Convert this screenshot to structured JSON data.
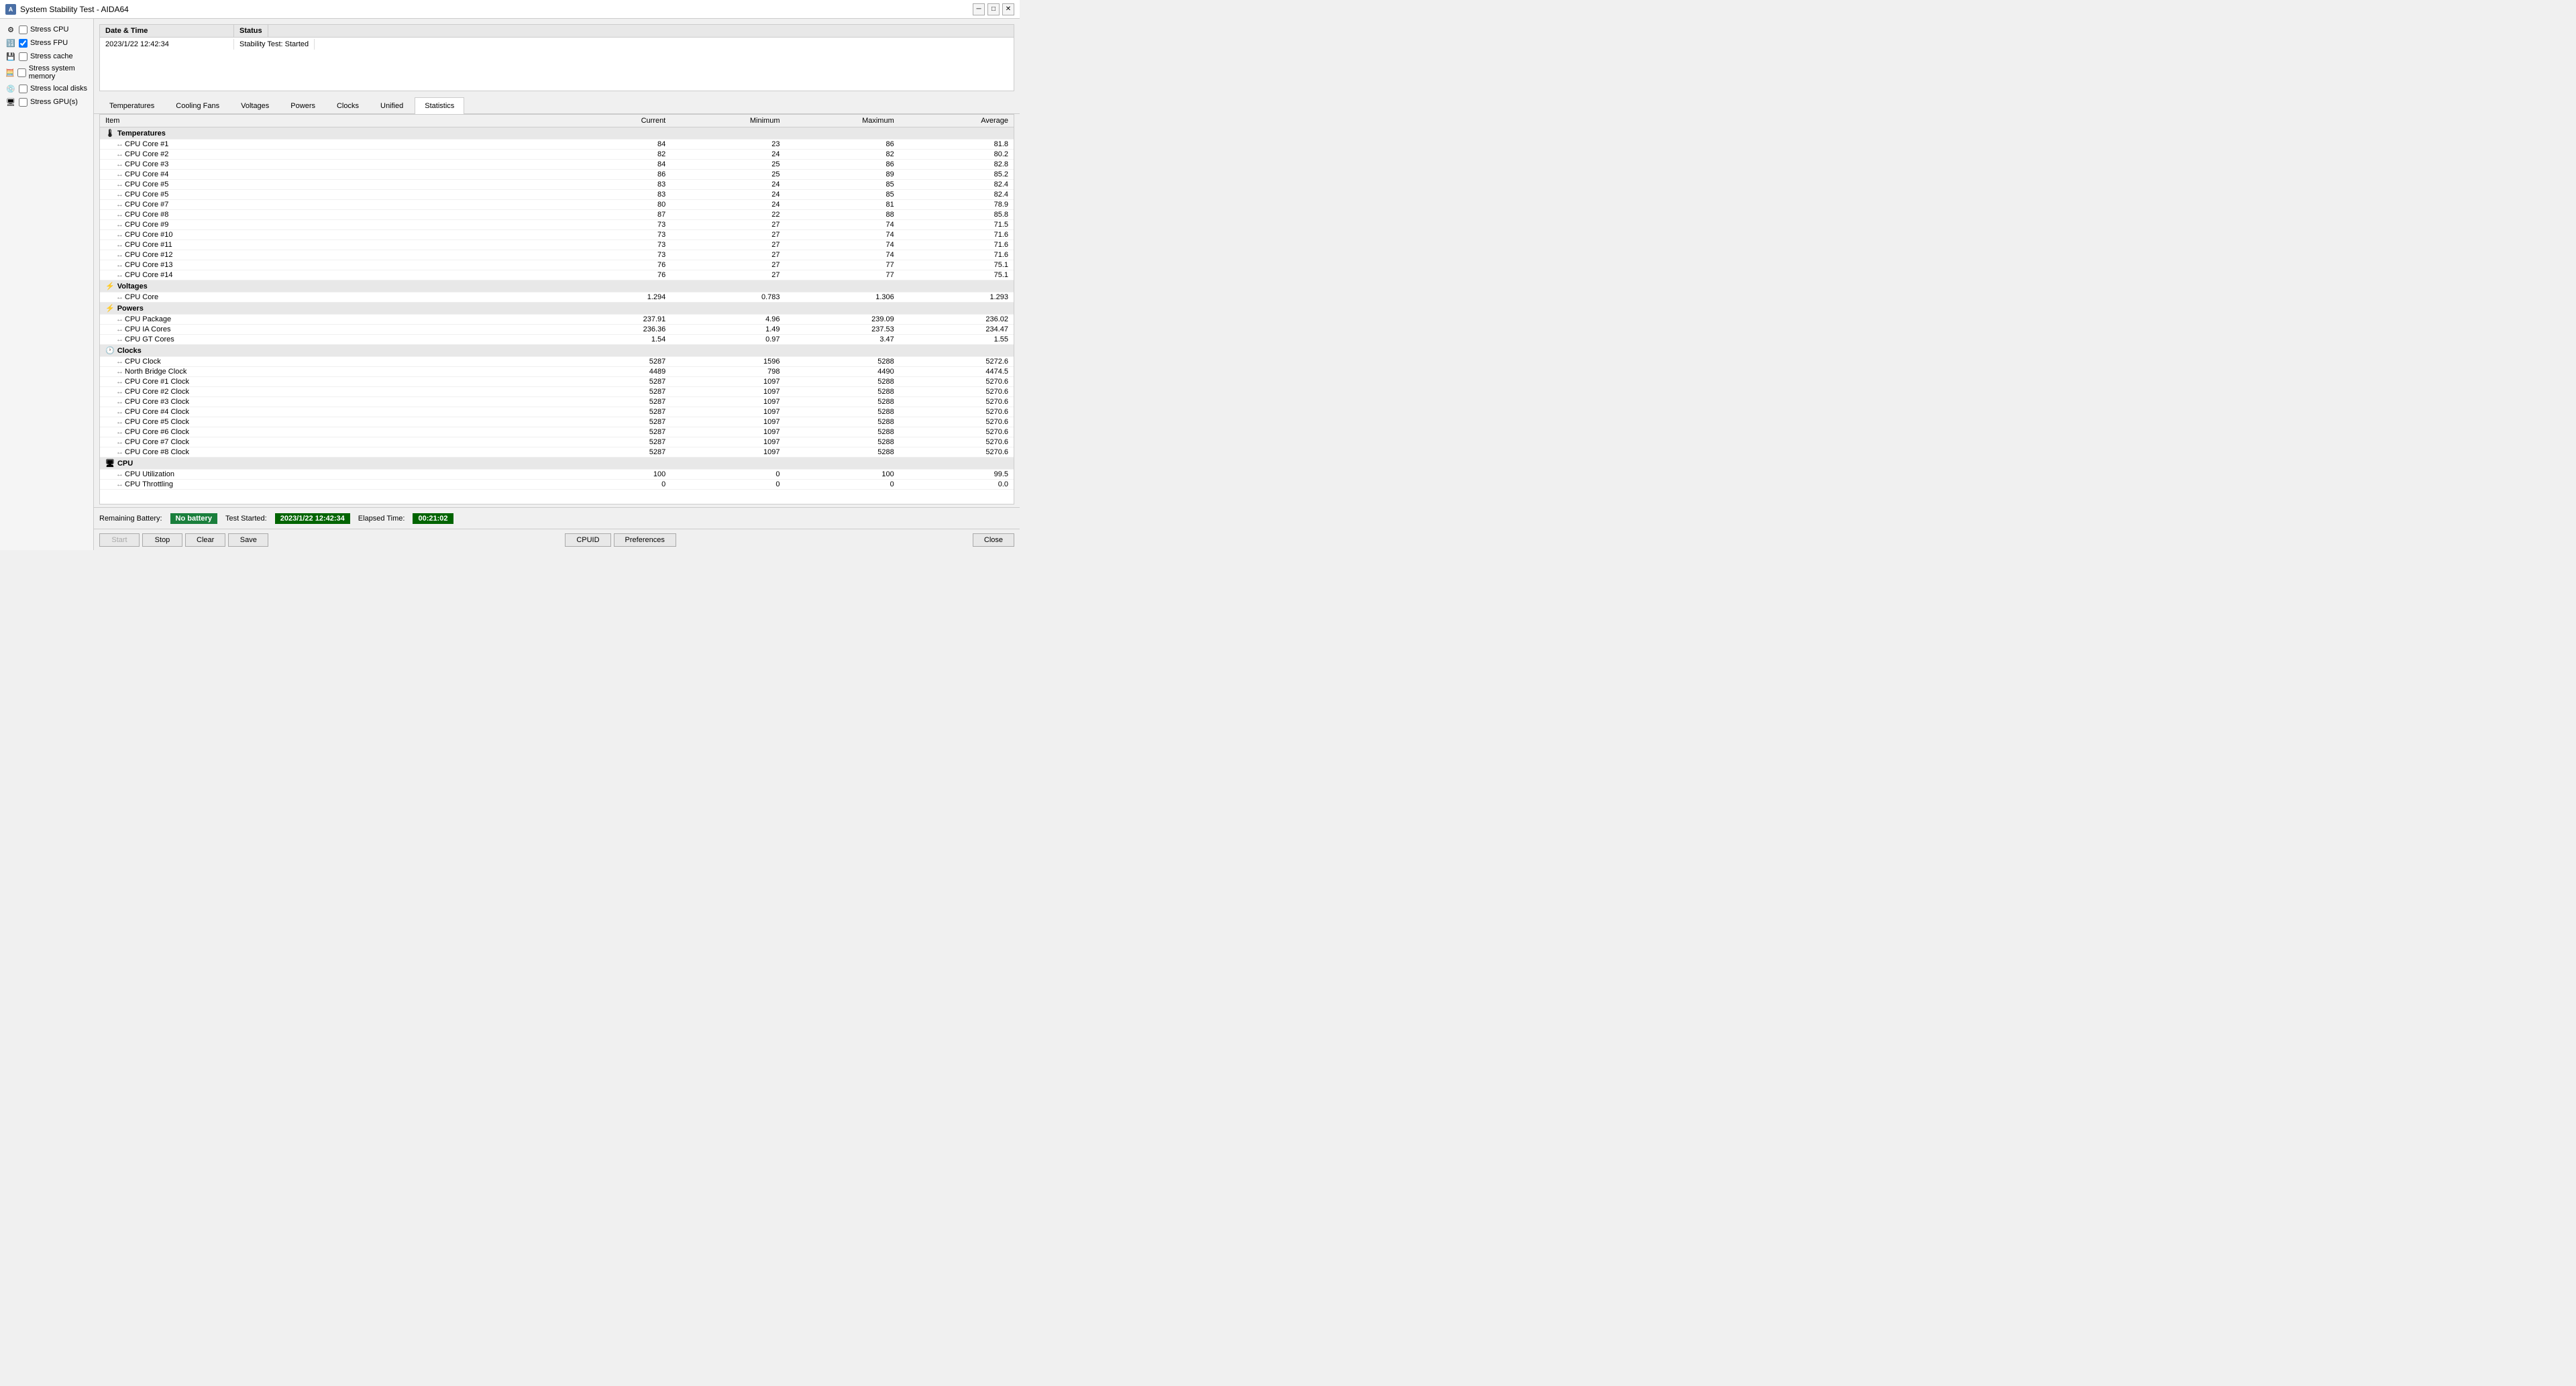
{
  "titleBar": {
    "title": "System Stability Test - AIDA64",
    "minimizeLabel": "─",
    "restoreLabel": "□",
    "closeLabel": "✕"
  },
  "leftPanel": {
    "stressItems": [
      {
        "id": "cpu",
        "label": "Stress CPU",
        "checked": false
      },
      {
        "id": "fpu",
        "label": "Stress FPU",
        "checked": true
      },
      {
        "id": "cache",
        "label": "Stress cache",
        "checked": false
      },
      {
        "id": "memory",
        "label": "Stress system memory",
        "checked": false
      },
      {
        "id": "disks",
        "label": "Stress local disks",
        "checked": false
      },
      {
        "id": "gpu",
        "label": "Stress GPU(s)",
        "checked": false
      }
    ]
  },
  "statusPanel": {
    "headers": [
      "Date & Time",
      "Status"
    ],
    "rows": [
      {
        "datetime": "2023/1/22 12:42:34",
        "status": "Stability Test: Started"
      }
    ]
  },
  "tabs": [
    {
      "id": "temperatures",
      "label": "Temperatures",
      "active": false
    },
    {
      "id": "coolingFans",
      "label": "Cooling Fans",
      "active": false
    },
    {
      "id": "voltages",
      "label": "Voltages",
      "active": false
    },
    {
      "id": "powers",
      "label": "Powers",
      "active": false
    },
    {
      "id": "clocks",
      "label": "Clocks",
      "active": false
    },
    {
      "id": "unified",
      "label": "Unified",
      "active": false
    },
    {
      "id": "statistics",
      "label": "Statistics",
      "active": true
    }
  ],
  "tableHeaders": [
    "Item",
    "Current",
    "Minimum",
    "Maximum",
    "Average"
  ],
  "tableData": {
    "groups": [
      {
        "name": "Temperatures",
        "icon": "temp",
        "rows": [
          {
            "item": "CPU Core #1",
            "current": "84",
            "minimum": "23",
            "maximum": "86",
            "average": "81.8"
          },
          {
            "item": "CPU Core #2",
            "current": "82",
            "minimum": "24",
            "maximum": "82",
            "average": "80.2"
          },
          {
            "item": "CPU Core #3",
            "current": "84",
            "minimum": "25",
            "maximum": "86",
            "average": "82.8"
          },
          {
            "item": "CPU Core #4",
            "current": "86",
            "minimum": "25",
            "maximum": "89",
            "average": "85.2"
          },
          {
            "item": "CPU Core #5",
            "current": "83",
            "minimum": "24",
            "maximum": "85",
            "average": "82.4"
          },
          {
            "item": "CPU Core #5",
            "current": "83",
            "minimum": "24",
            "maximum": "85",
            "average": "82.4"
          },
          {
            "item": "CPU Core #7",
            "current": "80",
            "minimum": "24",
            "maximum": "81",
            "average": "78.9"
          },
          {
            "item": "CPU Core #8",
            "current": "87",
            "minimum": "22",
            "maximum": "88",
            "average": "85.8"
          },
          {
            "item": "CPU Core #9",
            "current": "73",
            "minimum": "27",
            "maximum": "74",
            "average": "71.5"
          },
          {
            "item": "CPU Core #10",
            "current": "73",
            "minimum": "27",
            "maximum": "74",
            "average": "71.6"
          },
          {
            "item": "CPU Core #11",
            "current": "73",
            "minimum": "27",
            "maximum": "74",
            "average": "71.6"
          },
          {
            "item": "CPU Core #12",
            "current": "73",
            "minimum": "27",
            "maximum": "74",
            "average": "71.6"
          },
          {
            "item": "CPU Core #13",
            "current": "76",
            "minimum": "27",
            "maximum": "77",
            "average": "75.1"
          },
          {
            "item": "CPU Core #14",
            "current": "76",
            "minimum": "27",
            "maximum": "77",
            "average": "75.1"
          }
        ]
      },
      {
        "name": "Voltages",
        "icon": "voltage",
        "rows": [
          {
            "item": "CPU Core",
            "current": "1.294",
            "minimum": "0.783",
            "maximum": "1.306",
            "average": "1.293"
          }
        ]
      },
      {
        "name": "Powers",
        "icon": "power",
        "rows": [
          {
            "item": "CPU Package",
            "current": "237.91",
            "minimum": "4.96",
            "maximum": "239.09",
            "average": "236.02"
          },
          {
            "item": "CPU IA Cores",
            "current": "236.36",
            "minimum": "1.49",
            "maximum": "237.53",
            "average": "234.47"
          },
          {
            "item": "CPU GT Cores",
            "current": "1.54",
            "minimum": "0.97",
            "maximum": "3.47",
            "average": "1.55"
          }
        ]
      },
      {
        "name": "Clocks",
        "icon": "clock",
        "rows": [
          {
            "item": "CPU Clock",
            "current": "5287",
            "minimum": "1596",
            "maximum": "5288",
            "average": "5272.6"
          },
          {
            "item": "North Bridge Clock",
            "current": "4489",
            "minimum": "798",
            "maximum": "4490",
            "average": "4474.5"
          },
          {
            "item": "CPU Core #1 Clock",
            "current": "5287",
            "minimum": "1097",
            "maximum": "5288",
            "average": "5270.6"
          },
          {
            "item": "CPU Core #2 Clock",
            "current": "5287",
            "minimum": "1097",
            "maximum": "5288",
            "average": "5270.6"
          },
          {
            "item": "CPU Core #3 Clock",
            "current": "5287",
            "minimum": "1097",
            "maximum": "5288",
            "average": "5270.6"
          },
          {
            "item": "CPU Core #4 Clock",
            "current": "5287",
            "minimum": "1097",
            "maximum": "5288",
            "average": "5270.6"
          },
          {
            "item": "CPU Core #5 Clock",
            "current": "5287",
            "minimum": "1097",
            "maximum": "5288",
            "average": "5270.6"
          },
          {
            "item": "CPU Core #6 Clock",
            "current": "5287",
            "minimum": "1097",
            "maximum": "5288",
            "average": "5270.6"
          },
          {
            "item": "CPU Core #7 Clock",
            "current": "5287",
            "minimum": "1097",
            "maximum": "5288",
            "average": "5270.6"
          },
          {
            "item": "CPU Core #8 Clock",
            "current": "5287",
            "minimum": "1097",
            "maximum": "5288",
            "average": "5270.6"
          }
        ]
      },
      {
        "name": "CPU",
        "icon": "cpu",
        "rows": [
          {
            "item": "CPU Utilization",
            "current": "100",
            "minimum": "0",
            "maximum": "100",
            "average": "99.5"
          },
          {
            "item": "CPU Throttling",
            "current": "0",
            "minimum": "0",
            "maximum": "0",
            "average": "0.0"
          }
        ]
      }
    ]
  },
  "bottomBar": {
    "batteryLabel": "Remaining Battery:",
    "batteryValue": "No battery",
    "testStartedLabel": "Test Started:",
    "testStartedValue": "2023/1/22 12:42:34",
    "elapsedLabel": "Elapsed Time:",
    "elapsedValue": "00:21:02"
  },
  "buttons": {
    "start": "Start",
    "stop": "Stop",
    "clear": "Clear",
    "save": "Save",
    "cpuid": "CPUID",
    "preferences": "Preferences",
    "close": "Close"
  }
}
